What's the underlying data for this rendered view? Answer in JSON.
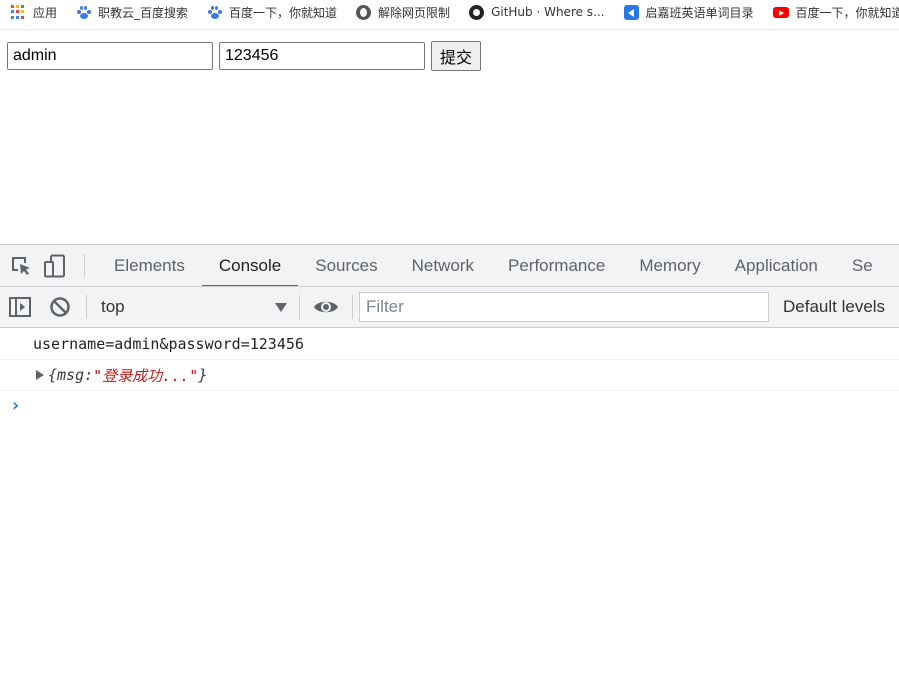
{
  "bookmarks": [
    {
      "icon": "apps-grid-icon",
      "label": "应用"
    },
    {
      "icon": "baidu-paw-icon",
      "label": "职教云_百度搜索"
    },
    {
      "icon": "baidu-paw-icon",
      "label": "百度一下，你就知道"
    },
    {
      "icon": "globe-icon",
      "label": "解除网页限制"
    },
    {
      "icon": "github-icon",
      "label": "GitHub · Where s..."
    },
    {
      "icon": "qijia-icon",
      "label": "启嘉班英语单词目录"
    },
    {
      "icon": "youtube-icon",
      "label": "百度一下，你就知道"
    }
  ],
  "form": {
    "username_value": "admin",
    "password_value": "123456",
    "submit_label": "提交"
  },
  "devtools": {
    "tabs": [
      "Elements",
      "Console",
      "Sources",
      "Network",
      "Performance",
      "Memory",
      "Application",
      "Se"
    ],
    "active_tab": "Console",
    "context": "top",
    "filter_placeholder": "Filter",
    "levels_label": "Default levels",
    "logs": {
      "line1": "username=admin&password=123456",
      "obj_open": "{msg: ",
      "obj_string": "\"登录成功...\"",
      "obj_close": "}"
    },
    "prompt_symbol": "›"
  },
  "colors": {
    "accent": "#1a73e8",
    "string": "#c41a16",
    "toolbar_bg": "#f1f3f4"
  }
}
